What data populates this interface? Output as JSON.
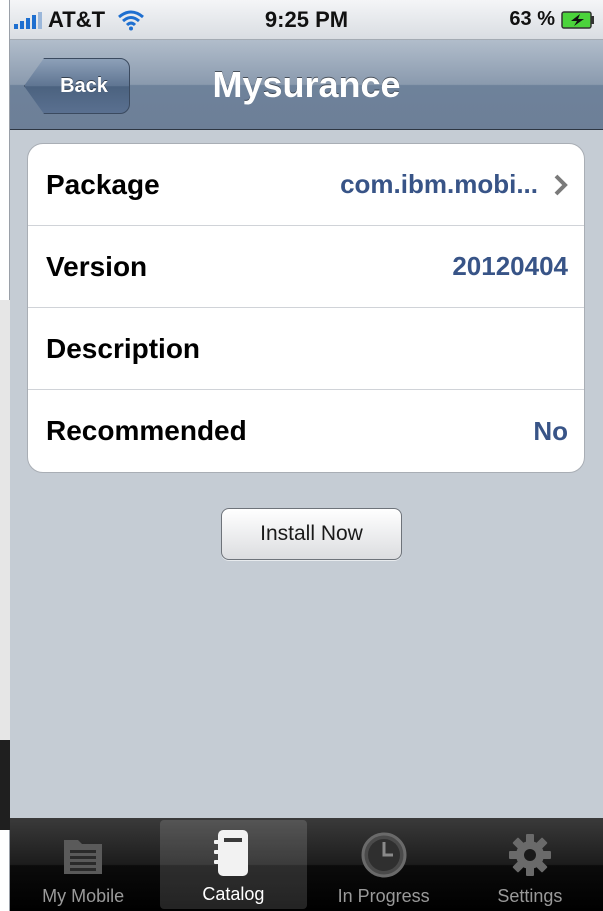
{
  "status_bar": {
    "carrier": "AT&T",
    "time": "9:25 PM",
    "battery": "63 %"
  },
  "nav": {
    "back_label": "Back",
    "title": "Mysurance"
  },
  "details": {
    "rows": [
      {
        "label": "Package",
        "value": "com.ibm.mobi..."
      },
      {
        "label": "Version",
        "value": "20120404"
      },
      {
        "label": "Description",
        "value": ""
      },
      {
        "label": "Recommended",
        "value": "No"
      }
    ]
  },
  "install_button_label": "Install Now",
  "tabs": [
    {
      "label": "My Mobile",
      "icon": "folder-list-icon"
    },
    {
      "label": "Catalog",
      "icon": "notebook-icon"
    },
    {
      "label": "In Progress",
      "icon": "clock-icon"
    },
    {
      "label": "Settings",
      "icon": "gear-icon"
    }
  ],
  "selected_tab": "Catalog",
  "colors": {
    "value_blue": "#385487",
    "nav_bar": "#6e829b",
    "background": "#c5ccd4"
  }
}
